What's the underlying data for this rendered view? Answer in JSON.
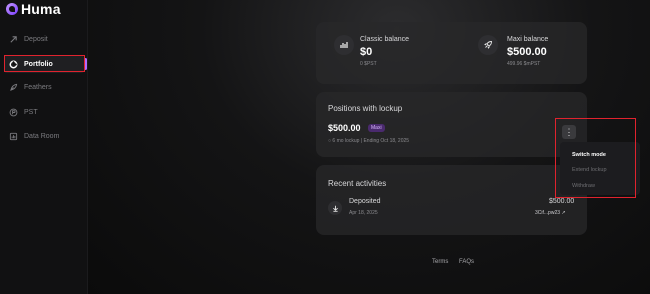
{
  "app": {
    "name": "Huma"
  },
  "sidebar": {
    "items": [
      {
        "label": "Deposit",
        "icon": "deposit-icon"
      },
      {
        "label": "Portfolio",
        "icon": "portfolio-icon",
        "active": true
      },
      {
        "label": "Feathers",
        "icon": "feather-icon"
      },
      {
        "label": "PST",
        "icon": "pst-icon"
      },
      {
        "label": "Data Room",
        "icon": "data-room-icon"
      }
    ]
  },
  "balances": {
    "classic": {
      "label": "Classic balance",
      "value": "$0",
      "sub": "0 $PST",
      "icon": "bar-chart-icon"
    },
    "maxi": {
      "label": "Maxi balance",
      "value": "$500.00",
      "sub": "499.96 $mPST",
      "icon": "rocket-icon"
    }
  },
  "positions": {
    "title": "Positions with lockup",
    "amount": "$500.00",
    "badge": "Maxi",
    "lockup_text": "6 mo lockup | Ending Oct 18, 2025",
    "menu": {
      "button": "⋮",
      "items": [
        "Switch mode",
        "Extend lockup",
        "Withdraw"
      ]
    }
  },
  "activities": {
    "title": "Recent activities",
    "items": [
      {
        "type": "Deposited",
        "date": "Apr 18, 2025",
        "amount": "$500.00",
        "tx": "3Cif...pw23"
      }
    ]
  },
  "footer": {
    "terms": "Terms",
    "faqs": "FAQs"
  },
  "colors": {
    "accent": "#b06cff",
    "highlight": "#e0232e",
    "badge_bg": "#4a2a6e"
  }
}
